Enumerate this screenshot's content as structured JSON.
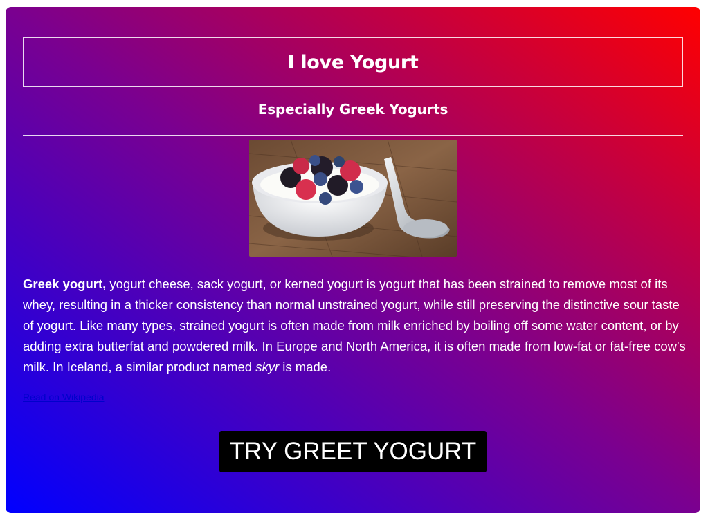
{
  "header": {
    "title": "I love Yogurt",
    "subtitle": "Especially Greek Yogurts"
  },
  "image": {
    "icon": "yogurt-bowl-with-berries-photo"
  },
  "description": {
    "bold_lead": "Greek yogurt,",
    "text_before_italic": " yogurt cheese, sack yogurt, or kerned yogurt is yogurt that has been strained to remove most of its whey, resulting in a thicker consistency than normal unstrained yogurt, while still preserving the distinctive sour taste of yogurt. Like many types, strained yogurt is often made from milk enriched by boiling off some water content, or by adding extra butterfat and powdered milk. In Europe and North America, it is often made from low-fat or fat-free cow's milk. In Iceland, a similar product named ",
    "italic_word": "skyr",
    "text_after_italic": " is made."
  },
  "link": {
    "label": "Read on Wikipedia"
  },
  "cta": {
    "label": "TRY GREET YOGURT"
  },
  "colors": {
    "gradient_start": "#0000ff",
    "gradient_end": "#ff0000",
    "button_bg": "#000000",
    "text": "#ffffff"
  }
}
